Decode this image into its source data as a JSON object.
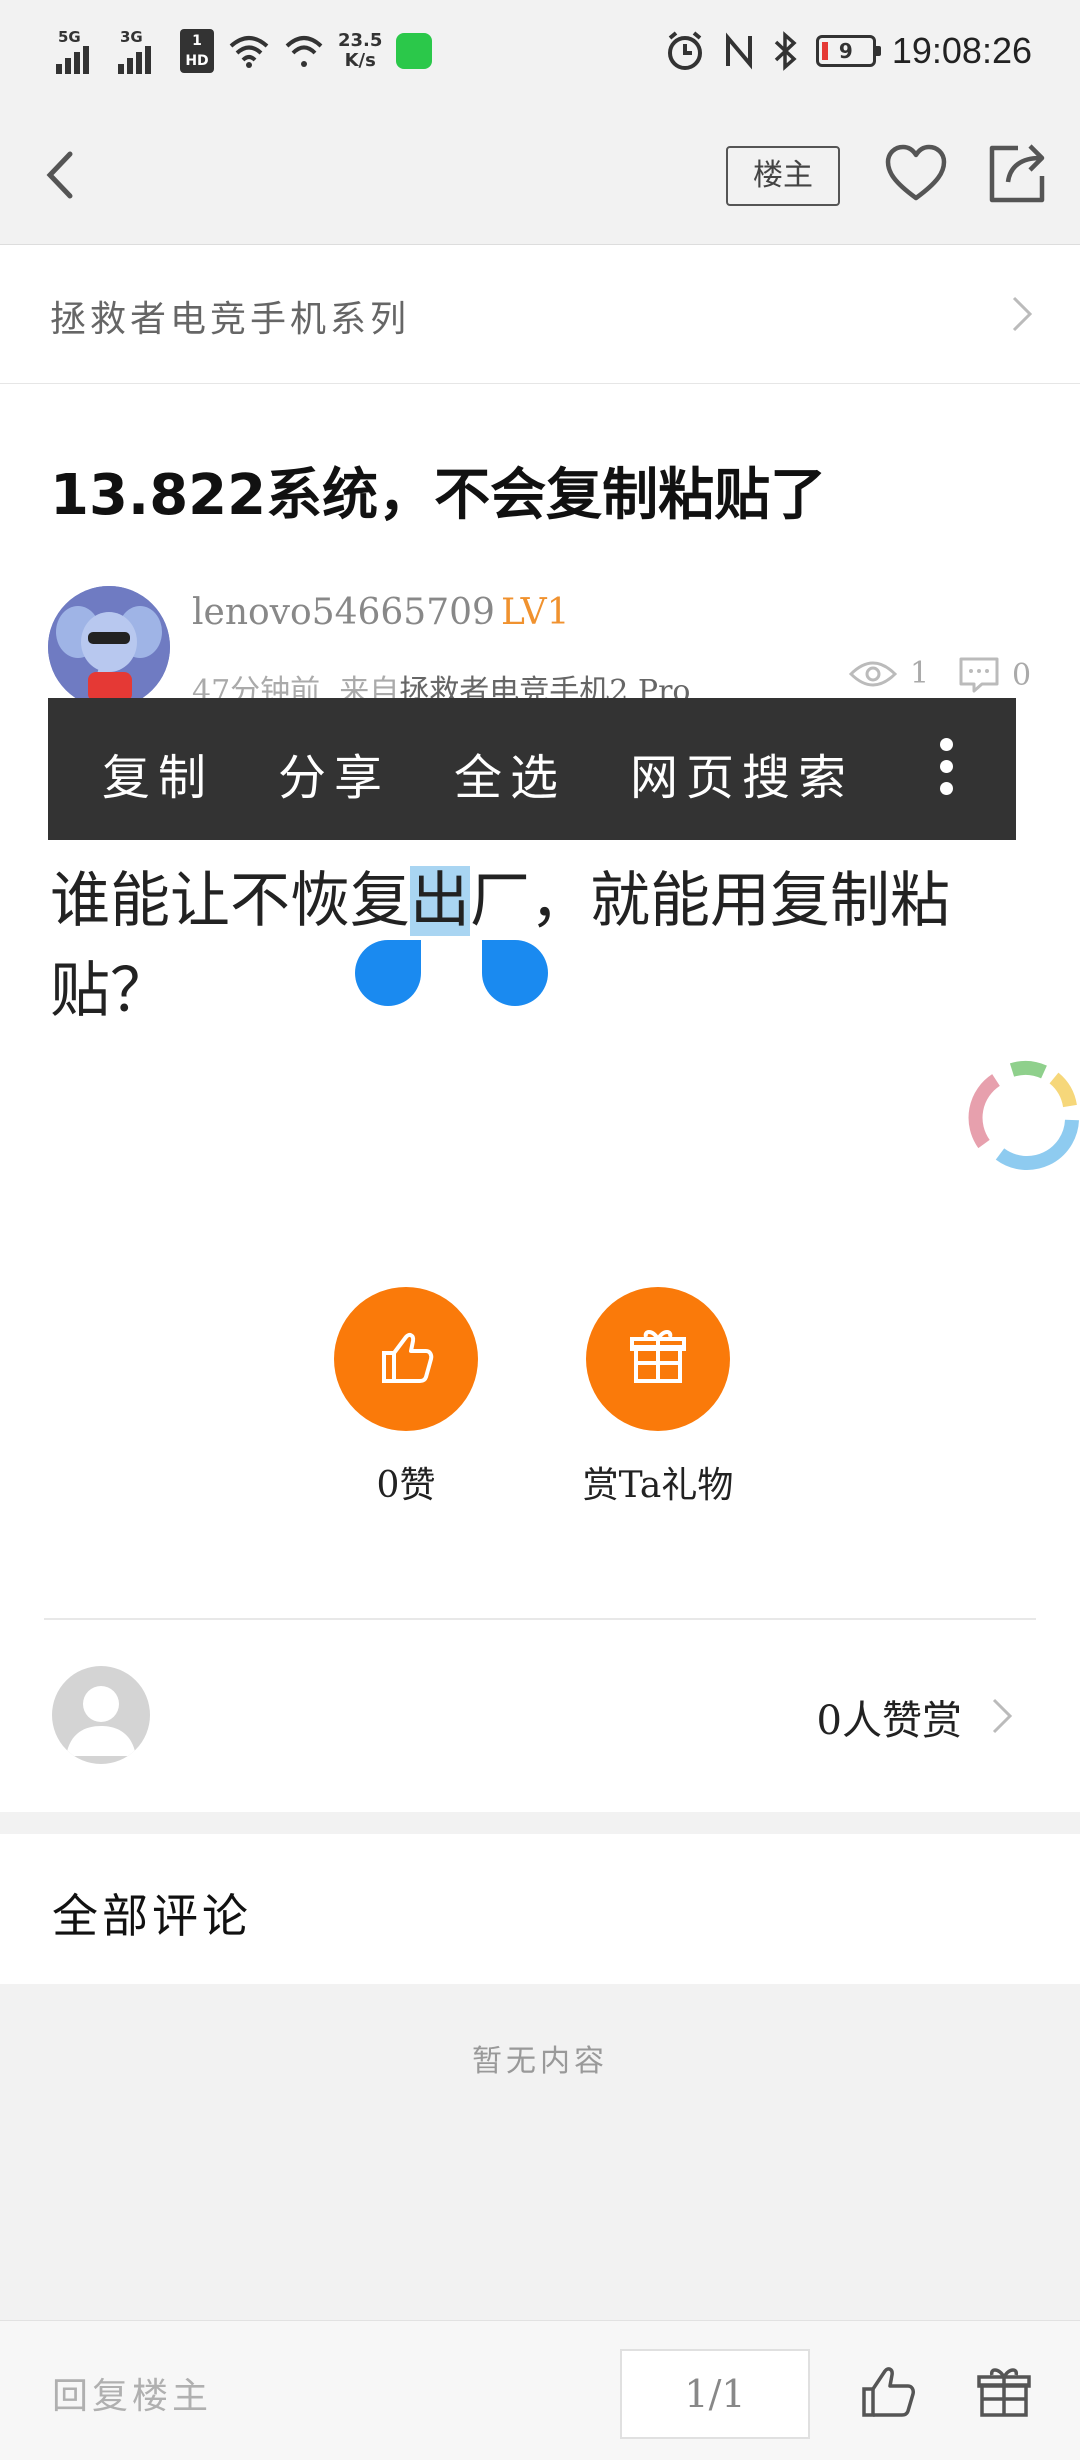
{
  "status_bar": {
    "signal1_label": "5G",
    "signal2_label": "3G",
    "hd_badge_top": "1",
    "hd_badge_bottom": "HD",
    "speed_value": "23.5",
    "speed_unit": "K/s",
    "battery_level": "9",
    "time": "19:08:26"
  },
  "nav": {
    "op_badge": "楼主"
  },
  "forum": {
    "name": "拯救者电竞手机系列"
  },
  "post": {
    "title": "13.822系统，不会复制粘贴了",
    "author": "lenovo54665709",
    "level": "LV1",
    "time_ago": "47分钟前",
    "source_prefix": "来自",
    "source_device": "拯救者电竞手机2 Pro",
    "views": "1",
    "comments": "0",
    "body_before": "谁能让不恢复",
    "body_selected": "出",
    "body_after": "厂，就能用复制粘贴？"
  },
  "context_menu": {
    "items": [
      "复制",
      "分享",
      "全选",
      "网页搜索"
    ]
  },
  "actions": {
    "like_label": "0赞",
    "gift_label": "赏Ta礼物"
  },
  "reward": {
    "count_label": "0人赞赏"
  },
  "comments": {
    "header": "全部评论",
    "empty_text": "暂无内容"
  },
  "bottom_bar": {
    "reply_placeholder": "回复楼主",
    "page_indicator": "1/1"
  },
  "colors": {
    "accent_orange": "#fa7a0a",
    "level_orange": "#f0922f",
    "selection_blue": "#a9d5f2",
    "handle_blue": "#1a8af0",
    "menu_dark": "#333333"
  }
}
